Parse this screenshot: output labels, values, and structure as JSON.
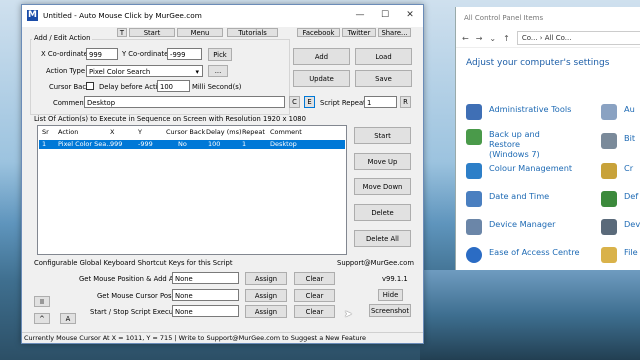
{
  "control_panel": {
    "title": "All Control Panel Items",
    "breadcrumb": [
      "Co...",
      "All Co..."
    ],
    "heading": "Adjust your computer's settings",
    "items": [
      {
        "label": "Administrative Tools",
        "color": "#3f6fb5"
      },
      {
        "label": "Back up and Restore (Windows 7)",
        "color": "#4a9a4a"
      },
      {
        "label": "Colour Management",
        "color": "#2d7fc8"
      },
      {
        "label": "Date and Time",
        "color": "#4a7fc0"
      },
      {
        "label": "Device Manager",
        "color": "#6b86a8"
      },
      {
        "label": "Ease of Access Centre",
        "color": "#2b6cc4"
      }
    ],
    "right_column": [
      "Au",
      "Bit",
      "Cr",
      "Def",
      "Dev",
      "File"
    ]
  },
  "app": {
    "title": "Untitled - Auto Mouse Click by MurGee.com",
    "icon_letter": "M",
    "toolbar": {
      "t": "T",
      "start": "Start",
      "menu": "Menu",
      "tutorials": "Tutorials",
      "facebook": "Facebook",
      "twitter": "Twitter",
      "share": "Share..."
    },
    "edit_group": {
      "title": "Add / Edit Action",
      "x_label": "X Co-ordinate :",
      "x_value": "999",
      "y_label": "Y Co-ordinate :",
      "y_value": "-999",
      "pick": "Pick",
      "action_type_label": "Action Type :",
      "action_type_value": "Pixel Color Search",
      "more": "...",
      "cursor_back_label": "Cursor Back :",
      "delay_label": "Delay before Action :",
      "delay_value": "100",
      "delay_unit": "Milli Second(s)",
      "comment_label": "Comment :",
      "comment_value": "Desktop",
      "c_btn": "C",
      "e_btn": "E",
      "repeat_label": "Script Repeat :",
      "repeat_value": "1",
      "r_btn": "R"
    },
    "side_buttons": {
      "add": "Add",
      "load": "Load",
      "update": "Update",
      "save": "Save"
    },
    "list_title": "List Of Action(s) to Execute in Sequence on Screen with Resolution 1920 x 1080",
    "columns": [
      "Sr",
      "Action",
      "X",
      "Y",
      "Cursor Back",
      "Delay (ms)",
      "Repeat",
      "Comment"
    ],
    "rows": [
      [
        "1",
        "Pixel Color Sea...",
        "999",
        "-999",
        "No",
        "100",
        "1",
        "Desktop"
      ]
    ],
    "list_buttons": {
      "start": "Start",
      "move_up": "Move Up",
      "move_down": "Move Down",
      "delete": "Delete",
      "delete_all": "Delete All"
    },
    "shortcut": {
      "title": "Configurable Global Keyboard Shortcut Keys for this Script",
      "support": "Support@MurGee.com",
      "version": "v99.1.1",
      "rows": [
        {
          "label": "Get Mouse Position & Add Action :",
          "value": "None",
          "assign": "Assign",
          "clear": "Clear"
        },
        {
          "label": "Get Mouse Cursor Position :",
          "value": "None",
          "assign": "Assign",
          "clear": "Clear"
        },
        {
          "label": "Start / Stop Script Execution :",
          "value": "None",
          "assign": "Assign",
          "clear": "Clear"
        }
      ],
      "hide": "Hide",
      "screenshot": "Screenshot",
      "pause": "II",
      "up": "^",
      "a": "A"
    },
    "status": "Currently Mouse Cursor At X = 1011, Y = 715 | Write to Support@MurGee.com to Suggest a New Feature"
  }
}
